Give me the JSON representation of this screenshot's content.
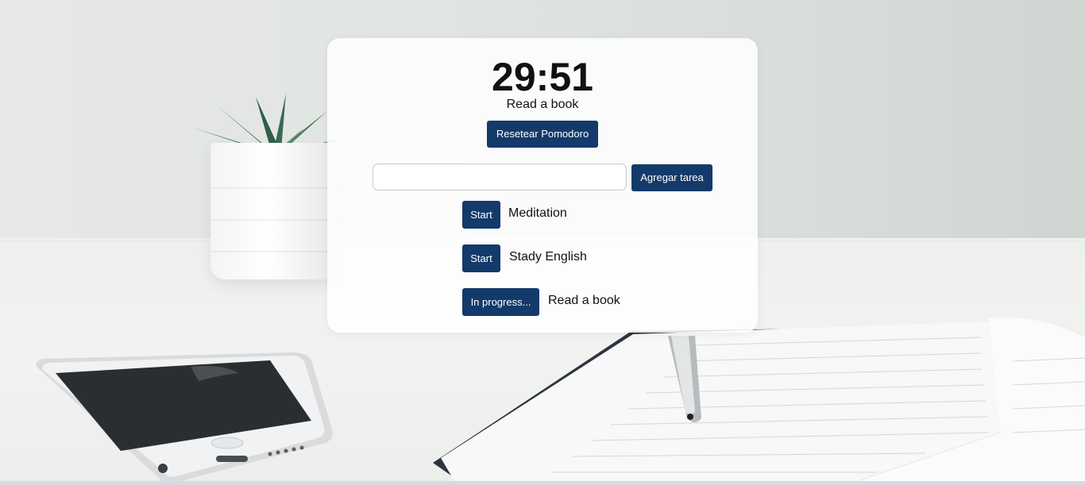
{
  "pomodoro": {
    "timer": "29:51",
    "current_task": "Read a book",
    "reset_label": "Resetear Pomodoro"
  },
  "add_task": {
    "input_value": "",
    "placeholder": "",
    "button_label": "Agregar tarea"
  },
  "tasks": [
    {
      "button_label": "Start",
      "name": "Meditation"
    },
    {
      "button_label": "Start",
      "name": "Stady English"
    },
    {
      "button_label": "In progress...",
      "name": "Read a book"
    }
  ],
  "colors": {
    "button": "#133a6a",
    "card": "#ffffff"
  }
}
